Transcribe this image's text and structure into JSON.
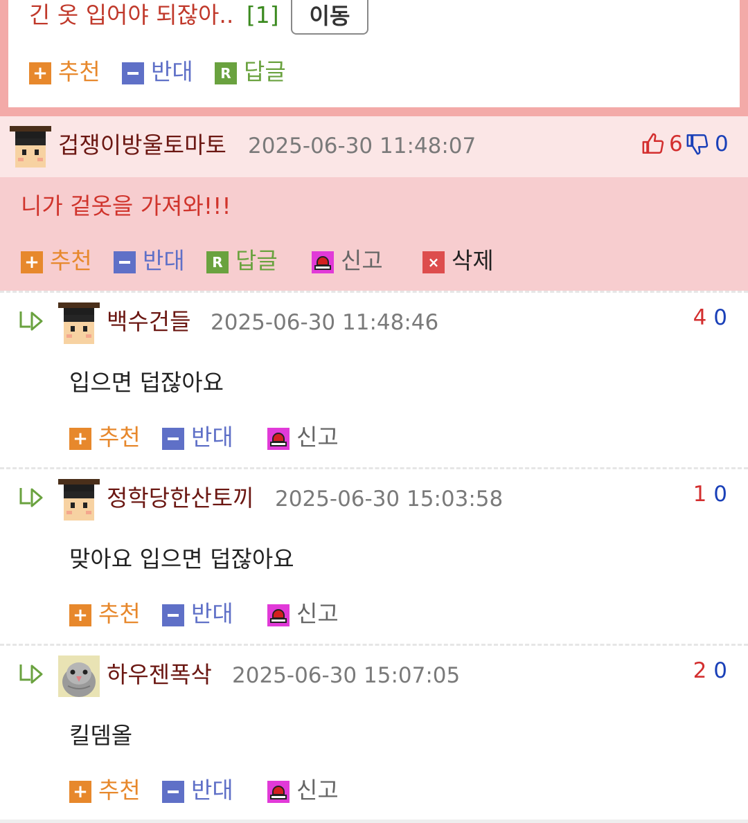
{
  "top": {
    "comment_text": "긴 옷 입어야 되잖아..",
    "comment_count": "[1]",
    "move_button": "이동",
    "actions": {
      "recommend": "추천",
      "oppose": "반대",
      "reply": "답글"
    }
  },
  "featured": {
    "username": "겁쟁이방울토마토",
    "datetime": "2025-06-30 11:48:07",
    "likes": "6",
    "dislikes": "0",
    "text": "니가 겉옷을 가져와!!!",
    "actions": {
      "recommend": "추천",
      "oppose": "반대",
      "reply": "답글",
      "report": "신고",
      "delete": "삭제"
    }
  },
  "replies": [
    {
      "username": "백수건들",
      "datetime": "2025-06-30 11:48:46",
      "up": "4",
      "down": "0",
      "text": "입으면 덥잖아요",
      "actions": {
        "recommend": "추천",
        "oppose": "반대",
        "report": "신고"
      }
    },
    {
      "username": "정학당한산토끼",
      "datetime": "2025-06-30 15:03:58",
      "up": "1",
      "down": "0",
      "text": "맞아요 입으면 덥잖아요",
      "actions": {
        "recommend": "추천",
        "oppose": "반대",
        "report": "신고"
      }
    },
    {
      "username": "하우젠폭삭",
      "datetime": "2025-06-30 15:07:05",
      "up": "2",
      "down": "0",
      "text": "킬뎀올",
      "actions": {
        "recommend": "추천",
        "oppose": "반대",
        "report": "신고"
      }
    }
  ],
  "colors": {
    "accent_pink": "#f3aaa8",
    "featured_bg": "#f7cdcf",
    "username": "#6b1712",
    "recommend": "#e7882c",
    "oppose": "#5f70c7",
    "reply": "#6aa23f"
  }
}
